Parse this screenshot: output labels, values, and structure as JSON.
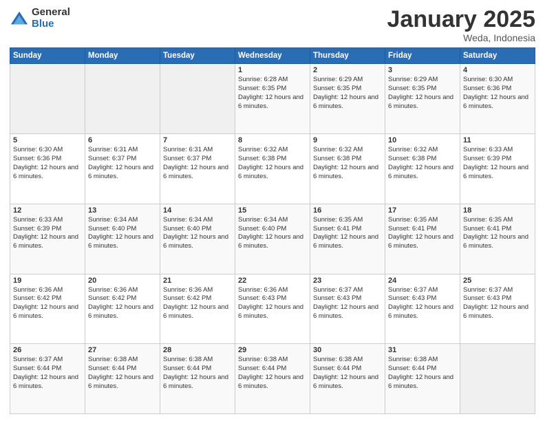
{
  "logo": {
    "general": "General",
    "blue": "Blue"
  },
  "title": {
    "month": "January 2025",
    "location": "Weda, Indonesia"
  },
  "days_header": [
    "Sunday",
    "Monday",
    "Tuesday",
    "Wednesday",
    "Thursday",
    "Friday",
    "Saturday"
  ],
  "weeks": [
    [
      {
        "day": "",
        "sunrise": "",
        "sunset": "",
        "daylight": ""
      },
      {
        "day": "",
        "sunrise": "",
        "sunset": "",
        "daylight": ""
      },
      {
        "day": "",
        "sunrise": "",
        "sunset": "",
        "daylight": ""
      },
      {
        "day": "1",
        "sunrise": "Sunrise: 6:28 AM",
        "sunset": "Sunset: 6:35 PM",
        "daylight": "Daylight: 12 hours and 6 minutes."
      },
      {
        "day": "2",
        "sunrise": "Sunrise: 6:29 AM",
        "sunset": "Sunset: 6:35 PM",
        "daylight": "Daylight: 12 hours and 6 minutes."
      },
      {
        "day": "3",
        "sunrise": "Sunrise: 6:29 AM",
        "sunset": "Sunset: 6:35 PM",
        "daylight": "Daylight: 12 hours and 6 minutes."
      },
      {
        "day": "4",
        "sunrise": "Sunrise: 6:30 AM",
        "sunset": "Sunset: 6:36 PM",
        "daylight": "Daylight: 12 hours and 6 minutes."
      }
    ],
    [
      {
        "day": "5",
        "sunrise": "Sunrise: 6:30 AM",
        "sunset": "Sunset: 6:36 PM",
        "daylight": "Daylight: 12 hours and 6 minutes."
      },
      {
        "day": "6",
        "sunrise": "Sunrise: 6:31 AM",
        "sunset": "Sunset: 6:37 PM",
        "daylight": "Daylight: 12 hours and 6 minutes."
      },
      {
        "day": "7",
        "sunrise": "Sunrise: 6:31 AM",
        "sunset": "Sunset: 6:37 PM",
        "daylight": "Daylight: 12 hours and 6 minutes."
      },
      {
        "day": "8",
        "sunrise": "Sunrise: 6:32 AM",
        "sunset": "Sunset: 6:38 PM",
        "daylight": "Daylight: 12 hours and 6 minutes."
      },
      {
        "day": "9",
        "sunrise": "Sunrise: 6:32 AM",
        "sunset": "Sunset: 6:38 PM",
        "daylight": "Daylight: 12 hours and 6 minutes."
      },
      {
        "day": "10",
        "sunrise": "Sunrise: 6:32 AM",
        "sunset": "Sunset: 6:38 PM",
        "daylight": "Daylight: 12 hours and 6 minutes."
      },
      {
        "day": "11",
        "sunrise": "Sunrise: 6:33 AM",
        "sunset": "Sunset: 6:39 PM",
        "daylight": "Daylight: 12 hours and 6 minutes."
      }
    ],
    [
      {
        "day": "12",
        "sunrise": "Sunrise: 6:33 AM",
        "sunset": "Sunset: 6:39 PM",
        "daylight": "Daylight: 12 hours and 6 minutes."
      },
      {
        "day": "13",
        "sunrise": "Sunrise: 6:34 AM",
        "sunset": "Sunset: 6:40 PM",
        "daylight": "Daylight: 12 hours and 6 minutes."
      },
      {
        "day": "14",
        "sunrise": "Sunrise: 6:34 AM",
        "sunset": "Sunset: 6:40 PM",
        "daylight": "Daylight: 12 hours and 6 minutes."
      },
      {
        "day": "15",
        "sunrise": "Sunrise: 6:34 AM",
        "sunset": "Sunset: 6:40 PM",
        "daylight": "Daylight: 12 hours and 6 minutes."
      },
      {
        "day": "16",
        "sunrise": "Sunrise: 6:35 AM",
        "sunset": "Sunset: 6:41 PM",
        "daylight": "Daylight: 12 hours and 6 minutes."
      },
      {
        "day": "17",
        "sunrise": "Sunrise: 6:35 AM",
        "sunset": "Sunset: 6:41 PM",
        "daylight": "Daylight: 12 hours and 6 minutes."
      },
      {
        "day": "18",
        "sunrise": "Sunrise: 6:35 AM",
        "sunset": "Sunset: 6:41 PM",
        "daylight": "Daylight: 12 hours and 6 minutes."
      }
    ],
    [
      {
        "day": "19",
        "sunrise": "Sunrise: 6:36 AM",
        "sunset": "Sunset: 6:42 PM",
        "daylight": "Daylight: 12 hours and 6 minutes."
      },
      {
        "day": "20",
        "sunrise": "Sunrise: 6:36 AM",
        "sunset": "Sunset: 6:42 PM",
        "daylight": "Daylight: 12 hours and 6 minutes."
      },
      {
        "day": "21",
        "sunrise": "Sunrise: 6:36 AM",
        "sunset": "Sunset: 6:42 PM",
        "daylight": "Daylight: 12 hours and 6 minutes."
      },
      {
        "day": "22",
        "sunrise": "Sunrise: 6:36 AM",
        "sunset": "Sunset: 6:43 PM",
        "daylight": "Daylight: 12 hours and 6 minutes."
      },
      {
        "day": "23",
        "sunrise": "Sunrise: 6:37 AM",
        "sunset": "Sunset: 6:43 PM",
        "daylight": "Daylight: 12 hours and 6 minutes."
      },
      {
        "day": "24",
        "sunrise": "Sunrise: 6:37 AM",
        "sunset": "Sunset: 6:43 PM",
        "daylight": "Daylight: 12 hours and 6 minutes."
      },
      {
        "day": "25",
        "sunrise": "Sunrise: 6:37 AM",
        "sunset": "Sunset: 6:43 PM",
        "daylight": "Daylight: 12 hours and 6 minutes."
      }
    ],
    [
      {
        "day": "26",
        "sunrise": "Sunrise: 6:37 AM",
        "sunset": "Sunset: 6:44 PM",
        "daylight": "Daylight: 12 hours and 6 minutes."
      },
      {
        "day": "27",
        "sunrise": "Sunrise: 6:38 AM",
        "sunset": "Sunset: 6:44 PM",
        "daylight": "Daylight: 12 hours and 6 minutes."
      },
      {
        "day": "28",
        "sunrise": "Sunrise: 6:38 AM",
        "sunset": "Sunset: 6:44 PM",
        "daylight": "Daylight: 12 hours and 6 minutes."
      },
      {
        "day": "29",
        "sunrise": "Sunrise: 6:38 AM",
        "sunset": "Sunset: 6:44 PM",
        "daylight": "Daylight: 12 hours and 6 minutes."
      },
      {
        "day": "30",
        "sunrise": "Sunrise: 6:38 AM",
        "sunset": "Sunset: 6:44 PM",
        "daylight": "Daylight: 12 hours and 6 minutes."
      },
      {
        "day": "31",
        "sunrise": "Sunrise: 6:38 AM",
        "sunset": "Sunset: 6:44 PM",
        "daylight": "Daylight: 12 hours and 6 minutes."
      },
      {
        "day": "",
        "sunrise": "",
        "sunset": "",
        "daylight": ""
      }
    ]
  ]
}
